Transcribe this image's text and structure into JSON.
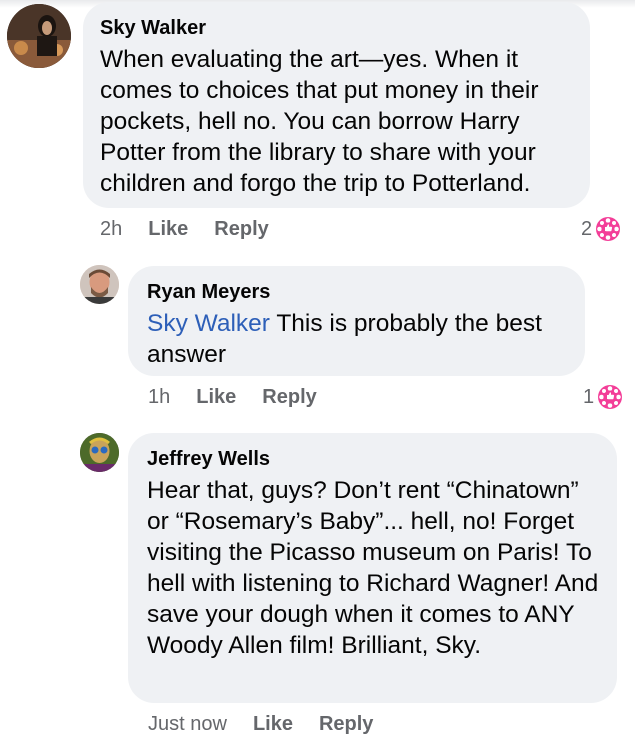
{
  "comments": [
    {
      "author": "Sky Walker",
      "mention": "",
      "text": "When evaluating the art—yes. When it comes to choices that put money in their pockets, hell no. You can borrow Harry Potter from the library to share with your children and forgo the trip to Potterland.",
      "time": "2h",
      "like_label": "Like",
      "reply_label": "Reply",
      "reaction_count": "2",
      "reaction_icon": "love-reaction-icon"
    },
    {
      "author": "Ryan Meyers",
      "mention": "Sky Walker",
      "text": " This is probably the best answer",
      "time": "1h",
      "like_label": "Like",
      "reply_label": "Reply",
      "reaction_count": "1",
      "reaction_icon": "love-reaction-icon"
    },
    {
      "author": "Jeffrey Wells",
      "mention": "",
      "text": "Hear that, guys?  Don’t rent “Chinatown” or “Rosemary’s Baby”... hell, no!  Forget visiting the Picasso museum on Paris!  To hell with listening to Richard Wagner! And save your dough when it comes to ANY Woody Allen film!  Brilliant, Sky.",
      "time": "Just now",
      "like_label": "Like",
      "reply_label": "Reply"
    }
  ],
  "colors": {
    "bubble": "#eff1f4",
    "mention": "#2d5fb8",
    "meta": "#65676b",
    "reaction": "#f33e98"
  }
}
